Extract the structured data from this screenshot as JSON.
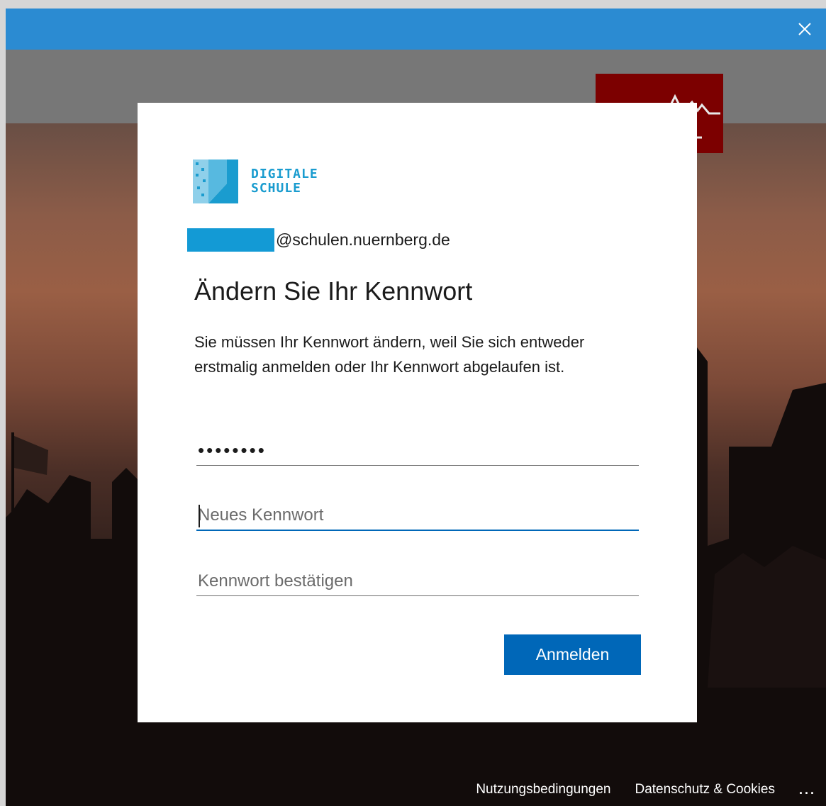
{
  "window": {
    "close_icon": "close-icon",
    "titlebar_color": "#2b8bd2"
  },
  "brand": {
    "line1": "DIGITALE",
    "line2": "SCHULE",
    "color": "#1a9ccf"
  },
  "account": {
    "domain": "@schulen.nuernberg.de"
  },
  "heading": "Ändern Sie Ihr Kennwort",
  "description": "Sie müssen Ihr Kennwort ändern, weil Sie sich entweder erstmalig anmelden oder Ihr Kennwort abgelaufen ist.",
  "fields": {
    "old_password_value": "••••••••",
    "new_password_placeholder": "Neues Kennwort",
    "confirm_password_placeholder": "Kennwort bestätigen"
  },
  "submit_label": "Anmelden",
  "footer": {
    "terms": "Nutzungsbedingungen",
    "privacy": "Datenschutz & Cookies",
    "more": "..."
  },
  "colors": {
    "primary": "#0067b8",
    "account_mask": "#139ad5",
    "banner": "#777777",
    "red_logo": "#7c0000"
  }
}
